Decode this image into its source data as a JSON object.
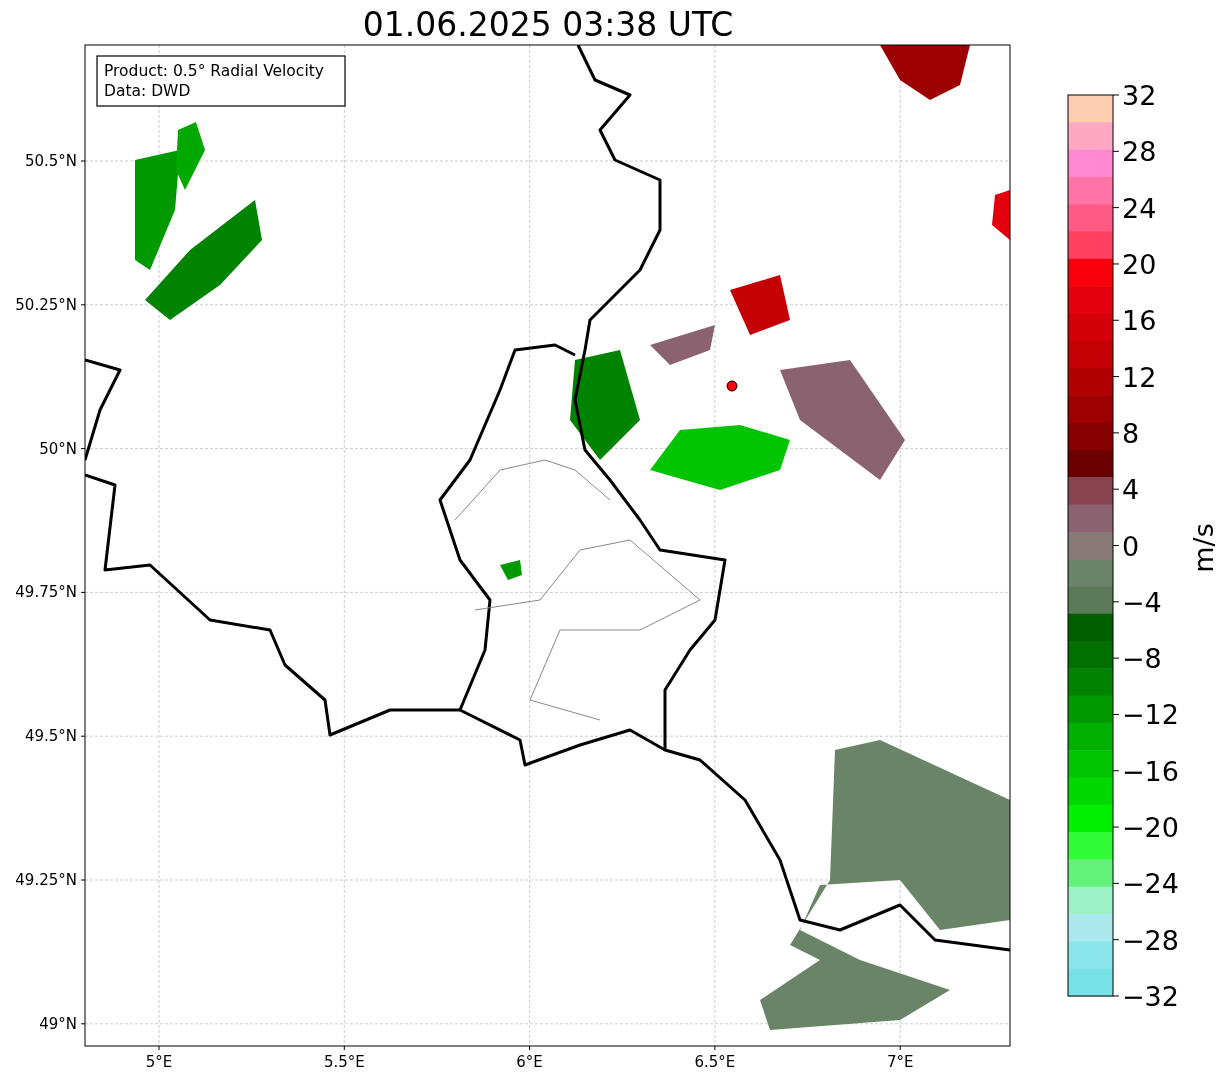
{
  "title": "01.06.2025 03:38 UTC",
  "info_box": [
    "Product: 0.5° Radial Velocity",
    "Data: DWD"
  ],
  "x_ticks": [
    "5°E",
    "5.5°E",
    "6°E",
    "6.5°E",
    "7°E"
  ],
  "y_ticks": [
    "50.5°N",
    "50.25°N",
    "50°N",
    "49.75°N",
    "49.5°N",
    "49.25°N",
    "49°N"
  ],
  "colorbar": {
    "label": "m/s",
    "ticks": [
      "32",
      "28",
      "24",
      "20",
      "16",
      "12",
      "8",
      "4",
      "0",
      "−4",
      "−8",
      "−12",
      "−16",
      "−20",
      "−24",
      "−28",
      "−32"
    ],
    "bins": [
      {
        "color": "#ffceb0"
      },
      {
        "color": "#ffa8c4"
      },
      {
        "color": "#ff88d0"
      },
      {
        "color": "#ff74a4"
      },
      {
        "color": "#ff5a86"
      },
      {
        "color": "#ff4060"
      },
      {
        "color": "#f8000c"
      },
      {
        "color": "#e4000c"
      },
      {
        "color": "#d40008"
      },
      {
        "color": "#c40004"
      },
      {
        "color": "#b00000"
      },
      {
        "color": "#9c0000"
      },
      {
        "color": "#860000"
      },
      {
        "color": "#6c0000"
      },
      {
        "color": "#874450"
      },
      {
        "color": "#8a6270"
      },
      {
        "color": "#877a78"
      },
      {
        "color": "#6a8468"
      },
      {
        "color": "#5a7a58"
      },
      {
        "color": "#006000"
      },
      {
        "color": "#007000"
      },
      {
        "color": "#008400"
      },
      {
        "color": "#009a00"
      },
      {
        "color": "#00b000"
      },
      {
        "color": "#00c400"
      },
      {
        "color": "#00d800"
      },
      {
        "color": "#00f000"
      },
      {
        "color": "#30fc38"
      },
      {
        "color": "#64f27c"
      },
      {
        "color": "#9ef2c8"
      },
      {
        "color": "#aae8ee"
      },
      {
        "color": "#8ae6ea"
      },
      {
        "color": "#76e2e6"
      }
    ]
  }
}
